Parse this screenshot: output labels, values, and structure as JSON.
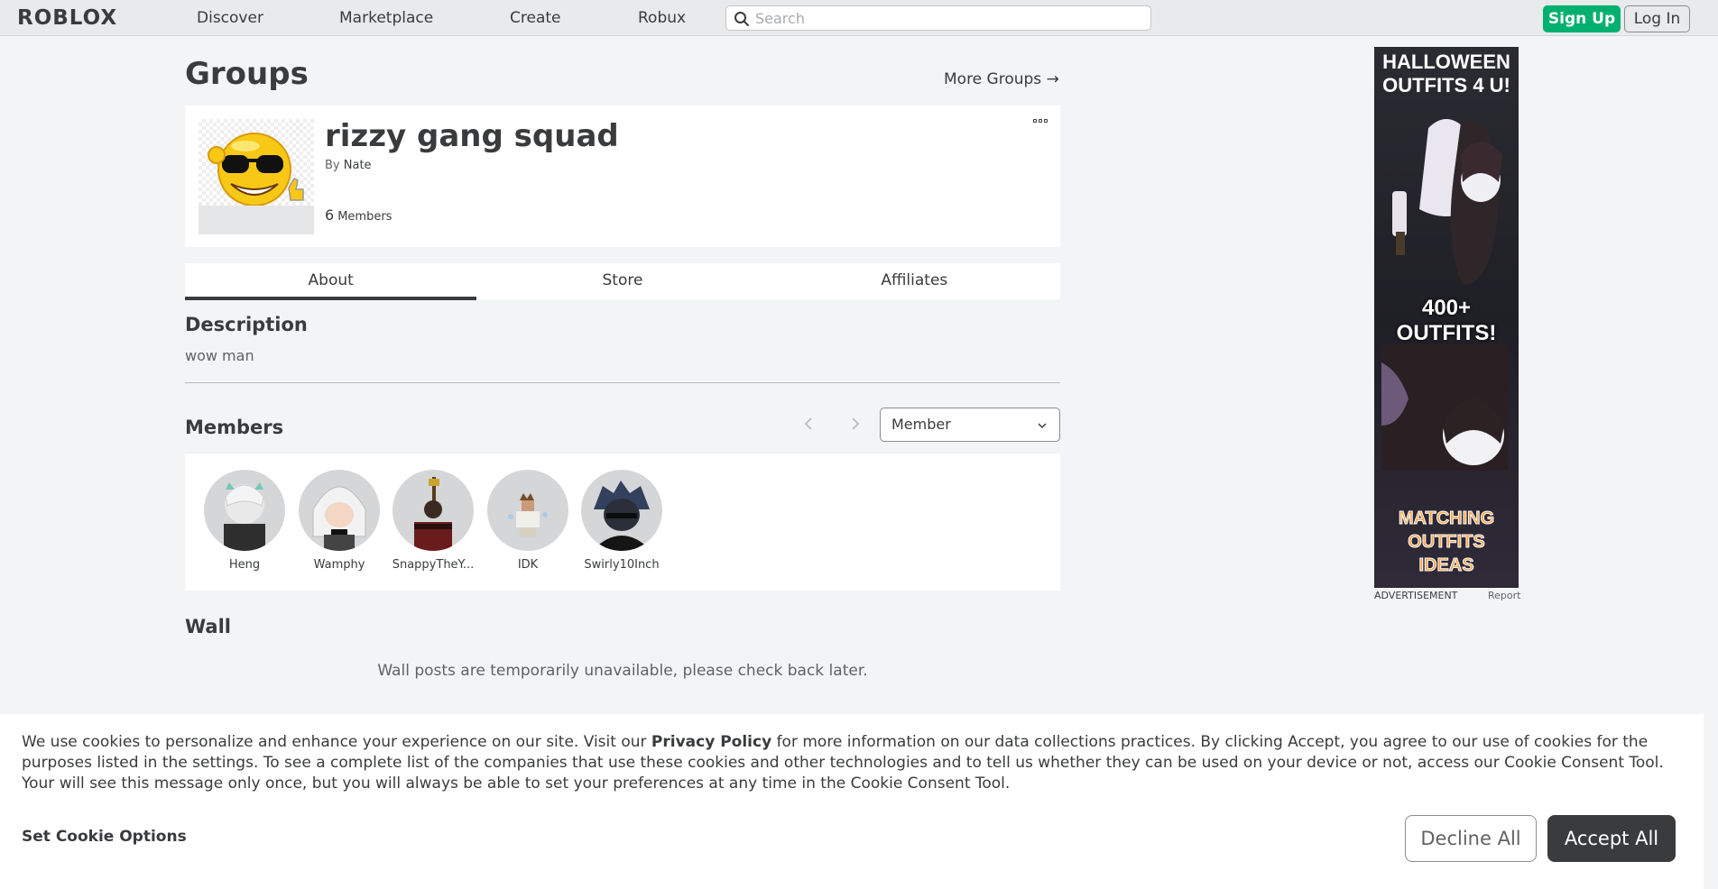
{
  "header": {
    "logo": "ROBLOX",
    "nav": [
      {
        "label": "Discover"
      },
      {
        "label": "Marketplace"
      },
      {
        "label": "Create"
      },
      {
        "label": "Robux"
      }
    ],
    "search": {
      "value": "",
      "placeholder": "Search"
    },
    "signup_label": "Sign Up",
    "login_label": "Log In"
  },
  "page": {
    "title": "Groups",
    "more_groups": "More Groups →"
  },
  "group": {
    "name": "rizzy gang squad",
    "by_prefix": "By",
    "owner": "Nate",
    "member_count": "6",
    "member_label": "Members"
  },
  "tabs": [
    {
      "label": "About",
      "active": true
    },
    {
      "label": "Store",
      "active": false
    },
    {
      "label": "Affiliates",
      "active": false
    }
  ],
  "description": {
    "title": "Description",
    "text": "wow man"
  },
  "members": {
    "title": "Members",
    "role_select": "Member",
    "list": [
      {
        "name": "Heng"
      },
      {
        "name": "Wamphy"
      },
      {
        "name": "SnappyTheY..."
      },
      {
        "name": "IDK"
      },
      {
        "name": "Swirly10Inch"
      }
    ]
  },
  "wall": {
    "title": "Wall",
    "message": "Wall posts are temporarily unavailable, please check back later."
  },
  "ad": {
    "headline": "HALLOWEEN OUTFITS 4 U!",
    "mid_text": "400+ OUTFITS!",
    "bottom_text": "MATCHING OUTFITS IDEAS",
    "label": "ADVERTISEMENT",
    "report": "Report"
  },
  "cookie": {
    "text_before": "We use cookies to personalize and enhance your experience on our site. Visit our ",
    "privacy_link": "Privacy Policy",
    "text_after": " for more information on our data collections practices. By clicking Accept, you agree to our use of cookies for the purposes listed in the settings. To see a complete list of the companies that use these cookies and other technologies and to tell us whether they can be used on your device or not, access our Cookie Consent Tool. Your will see this message only once, but you will always be able to set your preferences at any time in the Cookie Consent Tool.",
    "options_label": "Set Cookie Options",
    "decline_label": "Decline All",
    "accept_label": "Accept All"
  },
  "colors": {
    "accent_green": "#00b06f",
    "text_dark": "#393b3d",
    "background": "#f2f4f5"
  }
}
